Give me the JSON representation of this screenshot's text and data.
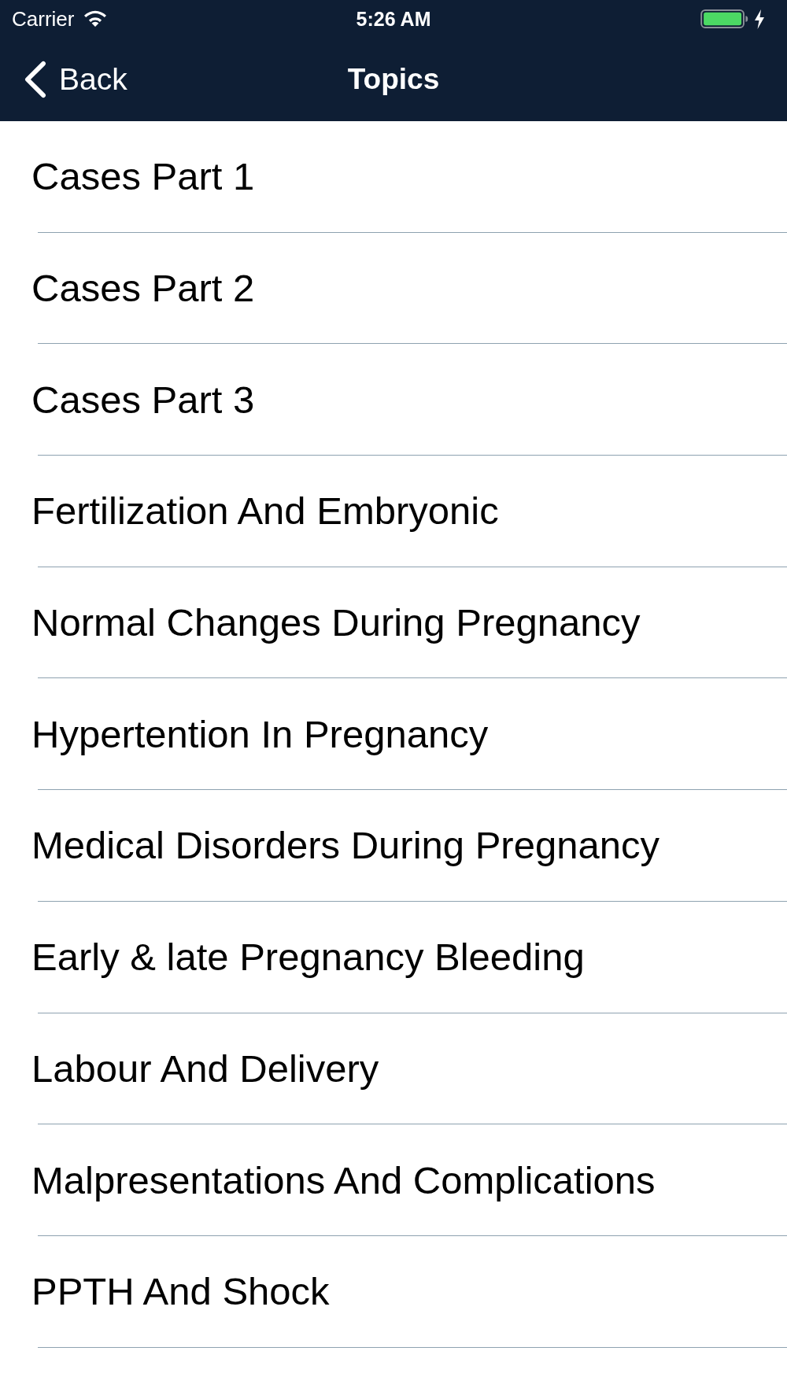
{
  "status_bar": {
    "carrier": "Carrier",
    "time": "5:26 AM"
  },
  "nav_bar": {
    "back": "Back",
    "title": "Topics"
  },
  "topics": [
    "Cases Part 1",
    "Cases Part 2",
    "Cases Part 3",
    "Fertilization And Embryonic",
    "Normal Changes During Pregnancy",
    "Hypertention In Pregnancy",
    "Medical Disorders During Pregnancy",
    "Early & late Pregnancy Bleeding",
    "Labour And Delivery",
    "Malpresentations And Complications",
    "PPTH And Shock"
  ]
}
